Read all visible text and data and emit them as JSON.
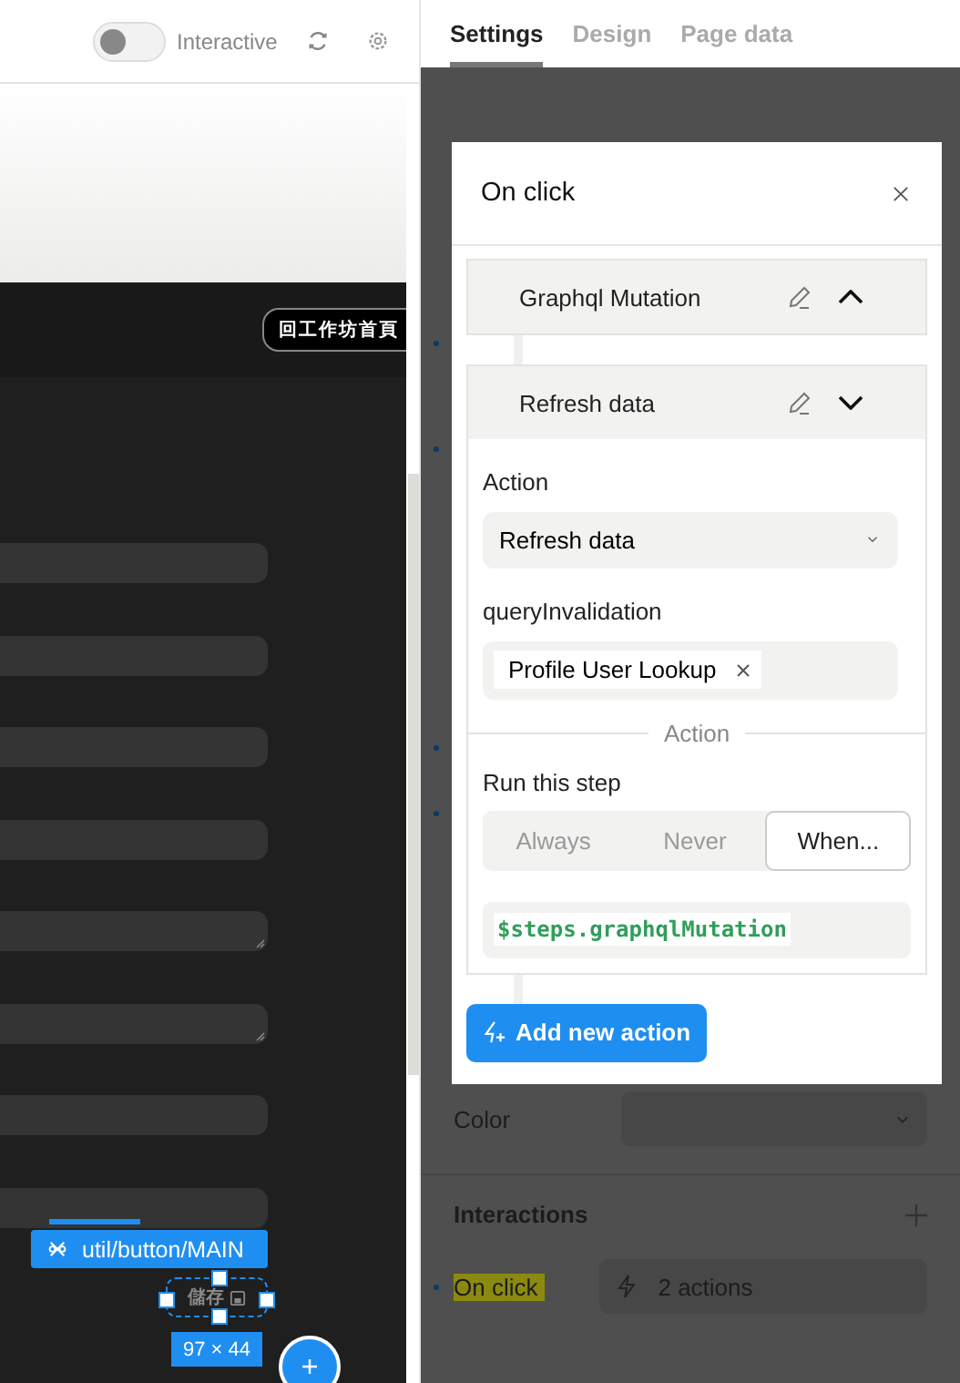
{
  "toolbar": {
    "toggle": {
      "label": "Interactive",
      "on": false
    }
  },
  "canvas": {
    "home_button": "回工作坊首頁",
    "fields": [
      {
        "kind": "input"
      },
      {
        "kind": "input"
      },
      {
        "kind": "input"
      },
      {
        "kind": "input"
      },
      {
        "kind": "textarea"
      },
      {
        "kind": "textarea"
      },
      {
        "kind": "input"
      },
      {
        "kind": "input"
      }
    ],
    "selection": {
      "component_label": "util/button/MAIN",
      "element_text": "儲存",
      "size": "97 × 44"
    }
  },
  "tabs": [
    {
      "label": "Settings",
      "selected": true
    },
    {
      "label": "Design",
      "selected": false
    },
    {
      "label": "Page data",
      "selected": false
    }
  ],
  "properties": {
    "color_label": "Color",
    "interactions_title": "Interactions",
    "event": {
      "label": "On click",
      "summary": "2 actions"
    }
  },
  "modal": {
    "title": "On click",
    "actions": [
      {
        "name": "Graphql Mutation",
        "expanded": false
      },
      {
        "name": "Refresh data",
        "expanded": true
      }
    ],
    "action_label": "Action",
    "action_value": "Refresh data",
    "query_label": "queryInvalidation",
    "query_tags": [
      "Profile User Lookup"
    ],
    "section_divider": "Action",
    "run_label": "Run this step",
    "run_options": [
      {
        "label": "Always",
        "selected": false
      },
      {
        "label": "Never",
        "selected": false
      },
      {
        "label": "When...",
        "selected": true
      }
    ],
    "condition": "$steps.graphqlMutation",
    "add_button": "Add new action"
  }
}
